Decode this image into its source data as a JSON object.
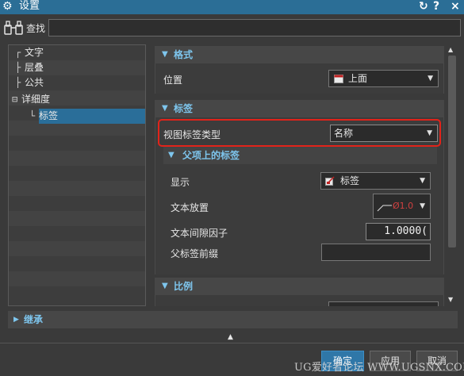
{
  "window": {
    "title": "设置",
    "controls": {
      "reset": "↻",
      "help": "?",
      "close": "×"
    }
  },
  "search": {
    "label": "查找",
    "value": "",
    "placeholder": ""
  },
  "tree": {
    "items": [
      {
        "label": "文字",
        "connector": "┌"
      },
      {
        "label": "层叠",
        "connector": "├"
      },
      {
        "label": "公共",
        "connector": "├"
      },
      {
        "label": "详细度",
        "connector": "⊟"
      },
      {
        "label": "标签",
        "connector": "└",
        "selected": true
      }
    ]
  },
  "panel": {
    "format": {
      "heading": "格式",
      "position_label": "位置",
      "position_value": "上面"
    },
    "labels": {
      "heading": "标签",
      "view_label_type_label": "视图标签类型",
      "view_label_type_value": "名称",
      "parent": {
        "heading": "父项上的标签",
        "display_label": "显示",
        "display_value": "标签",
        "text_placement_label": "文本放置",
        "text_placement_value": "Ø1.0",
        "text_gap_label": "文本间隙因子",
        "text_gap_value": "1.0000(",
        "prefix_label": "父标签前缀",
        "prefix_value": ""
      }
    },
    "scale": {
      "heading": "比例"
    }
  },
  "inherit": {
    "heading": "继承"
  },
  "buttons": {
    "ok": "确定",
    "apply": "应用",
    "cancel": "取消"
  },
  "watermark": "UG爱好者论坛 WWW.UGSNX.COM",
  "colors": {
    "title_bar": "#2b6e96",
    "section_heading": "#7ec6ee",
    "selection": "#2a6e99",
    "highlight": "#e2231a",
    "primary_button": "#2f77a8"
  }
}
